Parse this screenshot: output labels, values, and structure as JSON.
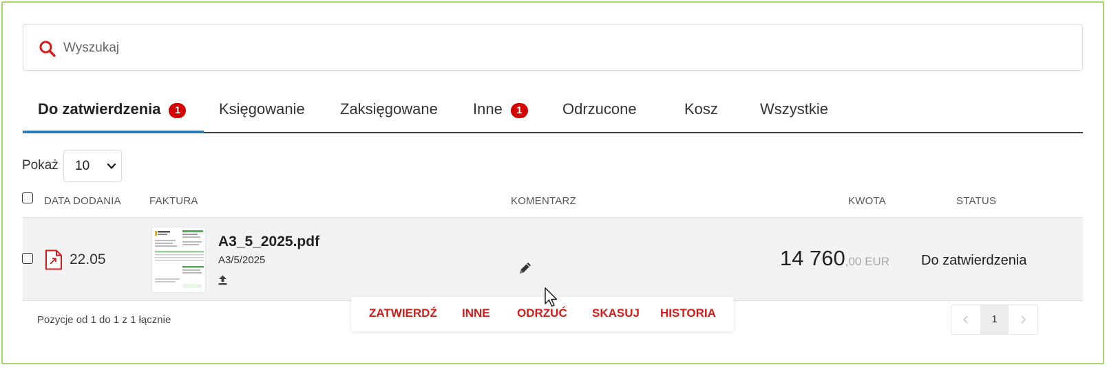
{
  "search": {
    "placeholder": "Wyszukaj",
    "icon": "search-icon",
    "icon_color": "#d71a1a"
  },
  "tabs": [
    {
      "label": "Do zatwierdzenia",
      "badge": "1",
      "active": true
    },
    {
      "label": "Księgowanie"
    },
    {
      "label": "Zaksięgowane"
    },
    {
      "label": "Inne",
      "badge": "1"
    },
    {
      "label": "Odrzucone"
    },
    {
      "label": "Kosz"
    },
    {
      "label": "Wszystkie"
    }
  ],
  "page_size": {
    "label": "Pokaż",
    "value": "10"
  },
  "columns": {
    "date": "DATA DODANIA",
    "invoice": "FAKTURA",
    "comment": "KOMENTARZ",
    "amount": "KWOTA",
    "status": "STATUS"
  },
  "rows": [
    {
      "date": "22.05",
      "file_name": "A3_5_2025.pdf",
      "invoice_number": "A3/5/2025",
      "amount_int": "14 760",
      "amount_dec": ",00 EUR",
      "status": "Do zatwierdzenia"
    }
  ],
  "actions": {
    "approve": "ZATWIERDŹ",
    "other": "INNE",
    "reject": "ODRZUĆ",
    "delete": "SKASUJ",
    "history": "HISTORIA"
  },
  "footer": {
    "info": "Pozycje od 1 do 1 z 1 łącznie"
  },
  "pagination": {
    "current": "1"
  },
  "colors": {
    "accent_red": "#d71a1a",
    "badge_red": "#d40000",
    "tab_underline": "#2c79b8",
    "frame_green": "#a6d96a"
  }
}
